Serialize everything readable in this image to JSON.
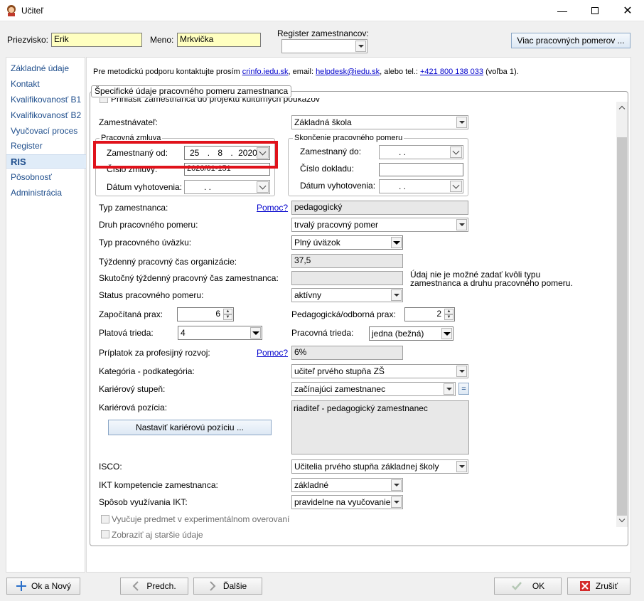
{
  "window": {
    "title": "Učiteľ"
  },
  "header": {
    "priezvisko_label": "Priezvisko:",
    "priezvisko_value": "Erik",
    "meno_label": "Meno:",
    "meno_value": "Mrkvička",
    "register_label": "Register zamestnancov:",
    "register_value": "",
    "viac_button": "Viac pracovných pomerov ..."
  },
  "sidebar": {
    "items": [
      {
        "label": "Základné údaje"
      },
      {
        "label": "Kontakt"
      },
      {
        "label": "Kvalifikovanosť B1"
      },
      {
        "label": "Kvalifikovanosť B2"
      },
      {
        "label": "Vyučovací proces"
      },
      {
        "label": "Register"
      },
      {
        "label": "RIS",
        "active": true
      },
      {
        "label": "Pôsobnosť"
      },
      {
        "label": "Administrácia"
      }
    ]
  },
  "info": {
    "prefix": "Pre metodickú podporu kontaktujte prosím ",
    "link1": "crinfo.iedu.sk",
    "mid1": ", email: ",
    "link2": "helpdesk@iedu.sk",
    "mid2": ", alebo tel.: ",
    "link3": "+421 800 138 033",
    "suffix": " (voľba 1)."
  },
  "panel": {
    "title": "Špecifické údaje pracovného pomeru zamestnanca",
    "clipped_checkbox": "Prihlásiť zamestnanca do projektu kultúrnych poukazov"
  },
  "form": {
    "zamestnavatel": {
      "label": "Zamestnávateľ:",
      "value": "Základná škola"
    },
    "pracovna_zmluva": {
      "title": "Pracovná zmluva",
      "zamestnany_od_label": "Zamestnaný od:",
      "zamestnany_od_day": "25",
      "zamestnany_od_month": "8",
      "zamestnany_od_year": "2020",
      "cislo_zmluvy_label": "Číslo zmluvy:",
      "cislo_zmluvy_value": "2020/01-151",
      "datum_label": "Dátum vyhotovenia:",
      "datum_value": ".     ."
    },
    "skoncenie": {
      "title": "Skončenie pracovného pomeru",
      "zamestnany_do_label": "Zamestnaný do:",
      "zamestnany_do_value": ".     .",
      "cislo_dokladu_label": "Číslo dokladu:",
      "cislo_dokladu_value": "",
      "datum_label": "Dátum vyhotovenia:",
      "datum_value": ".     ."
    },
    "typ_zamestnanca": {
      "label": "Typ zamestnanca:",
      "help": "Pomoc?",
      "value": "pedagogický"
    },
    "druh_pomeru": {
      "label": "Druh pracovného pomeru:",
      "value": "trvalý pracovný pomer"
    },
    "typ_uvazku": {
      "label": "Typ pracovného úväzku:",
      "value": "Plný úväzok"
    },
    "tyzdenny_cas_org": {
      "label": "Týždenný pracovný čas organizácie:",
      "value": "37,5"
    },
    "skutocny_cas": {
      "label": "Skutočný týždenný pracovný čas zamestnanca:",
      "value": "",
      "note1": "Údaj nie je možné zadať kvôli typu",
      "note2": "zamestnanca a druhu pracovného pomeru."
    },
    "status": {
      "label": "Status pracovného pomeru:",
      "value": "aktívny"
    },
    "zapocitana_prax": {
      "label": "Započítaná prax:",
      "value": "6"
    },
    "pedagogicka_prax": {
      "label": "Pedagogická/odborná prax:",
      "value": "2"
    },
    "platova_trieda": {
      "label": "Platová trieda:",
      "value": "4"
    },
    "pracovna_trieda": {
      "label": "Pracovná trieda:",
      "value": "jedna (bežná)"
    },
    "priplatok": {
      "label": "Príplatok za profesijný rozvoj:",
      "help": "Pomoc?",
      "value": "6%"
    },
    "kategoria": {
      "label": "Kategória - podkategória:",
      "value": "učiteľ prvého stupňa ZŠ"
    },
    "karierovy_stupen": {
      "label": "Kariérový stupeň:",
      "value": "začínajúci zamestnanec",
      "eq_button": "="
    },
    "karierova_pozicia": {
      "label": "Kariérová pozícia:",
      "value": "riaditeľ - pedagogický zamestnanec",
      "button": "Nastaviť kariérovú pozíciu ..."
    },
    "isco": {
      "label": "ISCO:",
      "value": "Učitelia prvého stupňa základnej školy"
    },
    "ikt_kompetencie": {
      "label": "IKT kompetencie zamestnanca:",
      "value": "základné"
    },
    "sposob_ikt": {
      "label": "Spôsob využívania IKT:",
      "value": "pravidelne na vyučovanie"
    },
    "experimental": {
      "label": "Vyučuje predmet v experimentálnom overovaní"
    },
    "starsie": {
      "label": "Zobraziť aj staršie údaje"
    }
  },
  "footer": {
    "ok_novy": "Ok a Nový",
    "predch": "Predch.",
    "dalsi": "Ďalšie",
    "ok": "OK",
    "zrusit": "Zrušiť"
  },
  "colors": {
    "highlight": "#e0121b",
    "link": "#0000cc",
    "yellow_field": "#ffffc0"
  }
}
